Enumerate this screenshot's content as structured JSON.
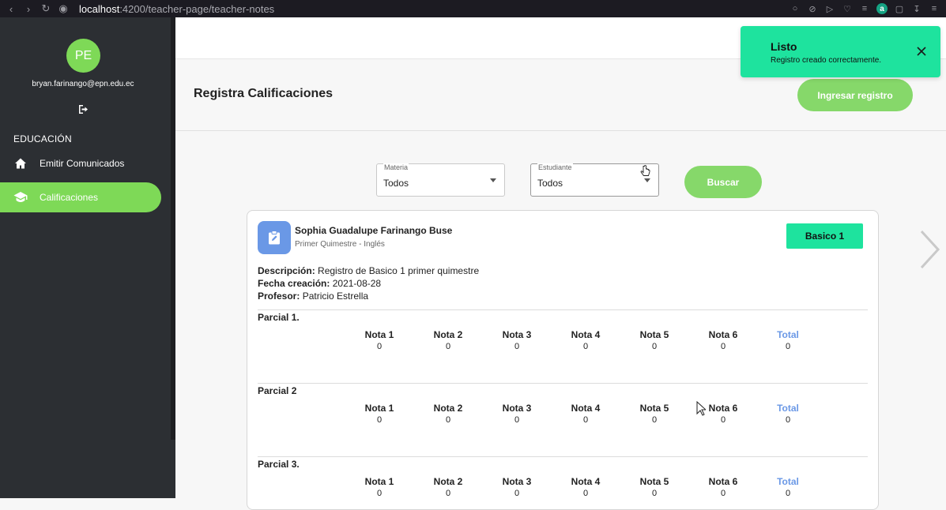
{
  "browser": {
    "url_host": "localhost",
    "url_path": ":4200/teacher-page/teacher-notes"
  },
  "sidebar": {
    "avatar_initials": "PE",
    "email": "bryan.farinango@epn.edu.ec",
    "section_label": "EDUCACIÓN",
    "items": [
      {
        "label": "Emitir Comunicados",
        "icon": "home-icon",
        "active": false
      },
      {
        "label": "Calificaciones",
        "icon": "school-icon",
        "active": true
      }
    ]
  },
  "header": {
    "title": "Registra Calificaciones",
    "add_button": "Ingresar registro"
  },
  "filters": {
    "materia": {
      "label": "Materia",
      "value": "Todos"
    },
    "estudiante": {
      "label": "Estudiante",
      "value": "Todos"
    },
    "search_button": "Buscar"
  },
  "card": {
    "student_name": "Sophia Guadalupe Farinango Buse",
    "subtitle": "Primer Quimestre - Inglés",
    "level": "Basico 1",
    "descripcion_label": "Descripción:",
    "descripcion": "Registro de Basico 1 primer quimestre",
    "fecha_label": "Fecha creación:",
    "fecha": "2021-08-28",
    "profesor_label": "Profesor:",
    "profesor": "Patricio Estrella",
    "parciales": [
      {
        "title": "Parcial 1.",
        "grades": [
          {
            "h": "Nota 1",
            "v": "0"
          },
          {
            "h": "Nota 2",
            "v": "0"
          },
          {
            "h": "Nota 3",
            "v": "0"
          },
          {
            "h": "Nota 4",
            "v": "0"
          },
          {
            "h": "Nota 5",
            "v": "0"
          },
          {
            "h": "Nota 6",
            "v": "0"
          },
          {
            "h": "Total",
            "v": "0"
          }
        ]
      },
      {
        "title": "Parcial 2",
        "grades": [
          {
            "h": "Nota 1",
            "v": "0"
          },
          {
            "h": "Nota 2",
            "v": "0"
          },
          {
            "h": "Nota 3",
            "v": "0"
          },
          {
            "h": "Nota 4",
            "v": "0"
          },
          {
            "h": "Nota 5",
            "v": "0"
          },
          {
            "h": "Nota 6",
            "v": "0"
          },
          {
            "h": "Total",
            "v": "0"
          }
        ]
      },
      {
        "title": "Parcial 3.",
        "grades": [
          {
            "h": "Nota 1",
            "v": "0"
          },
          {
            "h": "Nota 2",
            "v": "0"
          },
          {
            "h": "Nota 3",
            "v": "0"
          },
          {
            "h": "Nota 4",
            "v": "0"
          },
          {
            "h": "Nota 5",
            "v": "0"
          },
          {
            "h": "Nota 6",
            "v": "0"
          },
          {
            "h": "Total",
            "v": "0"
          }
        ]
      }
    ]
  },
  "toast": {
    "title": "Listo",
    "message": "Registro creado correctamente."
  },
  "colors": {
    "accent_green": "#7ed957",
    "toast_green": "#1ee39e",
    "total_blue": "#6a98e6",
    "sidebar_bg": "#2c2f33"
  }
}
